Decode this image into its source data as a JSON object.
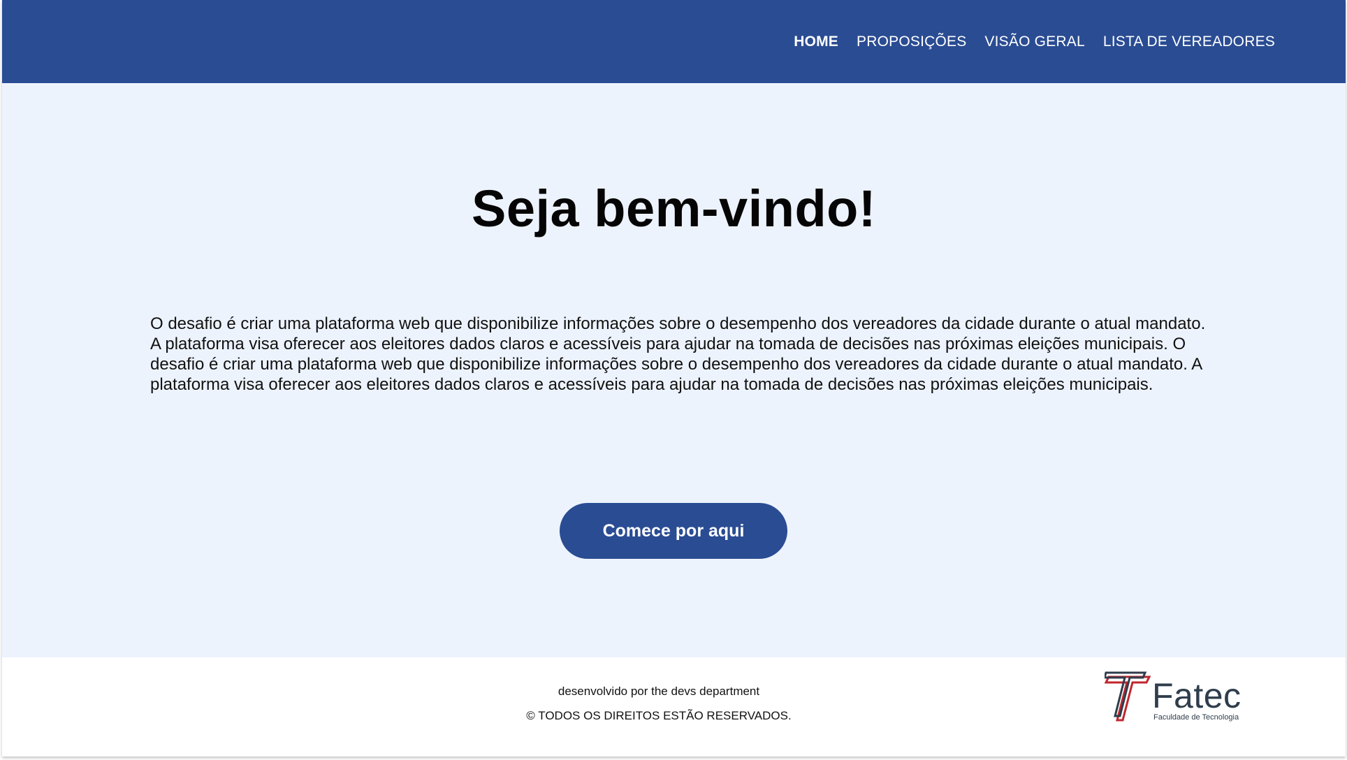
{
  "nav": {
    "items": [
      {
        "label": "HOME",
        "active": true
      },
      {
        "label": "PROPOSIÇÕES",
        "active": false
      },
      {
        "label": "VISÃO GERAL",
        "active": false
      },
      {
        "label": "LISTA DE VEREADORES",
        "active": false
      }
    ]
  },
  "main": {
    "title": "Seja bem-vindo!",
    "intro": "O desafio é criar uma plataforma web que disponibilize informações sobre o desempenho dos vereadores da cidade durante o atual mandato. A plataforma visa oferecer aos eleitores dados claros e acessíveis para ajudar na tomada de decisões nas próximas eleições municipais. O desafio é criar uma plataforma web que disponibilize informações sobre o desempenho dos vereadores da cidade durante o atual mandato. A plataforma visa oferecer aos eleitores dados claros e acessíveis para ajudar na tomada de decisões nas próximas eleições municipais.",
    "cta_label": "Comece por aqui"
  },
  "footer": {
    "credit": "desenvolvido por the devs department",
    "copyright": "© TODOS OS DIREITOS ESTÃO RESERVADOS.",
    "logo": {
      "word": "Fatec",
      "subtitle": "Faculdade de Tecnologia",
      "icon": "fatec-logo-icon"
    }
  },
  "colors": {
    "primary": "#2a4c93",
    "main_bg": "#edf3fd",
    "footer_bg": "#ffffff",
    "logo_red": "#c0262d",
    "logo_dark": "#2f3d4c"
  }
}
